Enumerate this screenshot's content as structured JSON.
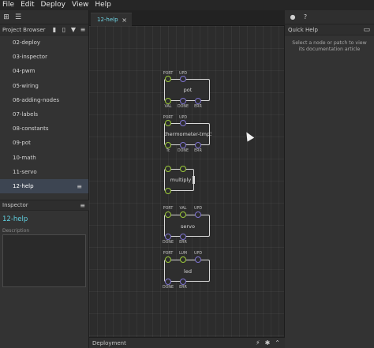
{
  "menu": [
    "File",
    "Edit",
    "Deploy",
    "View",
    "Help"
  ],
  "left_toolbar": {
    "icons": [
      "add-patch-icon",
      "sliders-icon"
    ]
  },
  "project_browser": {
    "title": "Project Browser",
    "icons": [
      "new-patch-icon",
      "document-icon",
      "filter-icon",
      "menu-icon"
    ],
    "items": [
      {
        "label": "02-deploy",
        "active": false
      },
      {
        "label": "03-inspector",
        "active": false
      },
      {
        "label": "04-pwm",
        "active": false
      },
      {
        "label": "05-wiring",
        "active": false
      },
      {
        "label": "06-adding-nodes",
        "active": false
      },
      {
        "label": "07-labels",
        "active": false
      },
      {
        "label": "08-constants",
        "active": false
      },
      {
        "label": "09-pot",
        "active": false
      },
      {
        "label": "10-math",
        "active": false
      },
      {
        "label": "11-servo",
        "active": false
      },
      {
        "label": "12-help",
        "active": true
      }
    ]
  },
  "inspector": {
    "title": "Inspector",
    "patch_name": "12-help",
    "description_label": "Description",
    "description_value": ""
  },
  "tab": {
    "label": "12-help",
    "close": "×"
  },
  "nodes": [
    {
      "name": "pot",
      "top_pins": [
        {
          "label": "PORT",
          "color": "green"
        },
        {
          "label": "UPD",
          "color": "blue"
        }
      ],
      "bottom_pins": [
        {
          "label": "VAL",
          "color": "green"
        },
        {
          "label": "DONE",
          "color": "blue"
        },
        {
          "label": "ERR",
          "color": "blue"
        }
      ]
    },
    {
      "name": "thermometer-tmp3...",
      "top_pins": [
        {
          "label": "PORT",
          "color": "green"
        },
        {
          "label": "UPD",
          "color": "blue"
        }
      ],
      "bottom_pins": [
        {
          "label": "Tc",
          "color": "green"
        },
        {
          "label": "DONE",
          "color": "blue"
        },
        {
          "label": "ERR",
          "color": "blue"
        }
      ]
    },
    {
      "name": "multiply",
      "top_pins": [
        {
          "label": "",
          "color": "green"
        },
        {
          "label": "",
          "color": "green"
        }
      ],
      "bottom_pins": [
        {
          "label": "",
          "color": "green"
        }
      ]
    },
    {
      "name": "servo",
      "top_pins": [
        {
          "label": "PORT",
          "color": "green"
        },
        {
          "label": "VAL",
          "color": "green"
        },
        {
          "label": "UPD",
          "color": "blue"
        }
      ],
      "bottom_pins": [
        {
          "label": "DONE",
          "color": "blue"
        },
        {
          "label": "ERR",
          "color": "blue"
        }
      ]
    },
    {
      "name": "led",
      "top_pins": [
        {
          "label": "PORT",
          "color": "green"
        },
        {
          "label": "LUM",
          "color": "green"
        },
        {
          "label": "UPD",
          "color": "blue"
        }
      ],
      "bottom_pins": [
        {
          "label": "DONE",
          "color": "blue"
        },
        {
          "label": "ERR",
          "color": "blue"
        }
      ]
    }
  ],
  "right_toolbar": {
    "icons": [
      "user-icon",
      "help-circle-icon"
    ]
  },
  "quick_help": {
    "title": "Quick Help",
    "text": "Select a node or patch to view its documentation article"
  },
  "deployment": {
    "title": "Deployment",
    "icons": [
      "flash-icon",
      "bug-icon",
      "chevron-up-icon"
    ]
  },
  "colors": {
    "accent": "#5fd0e0",
    "pin_green": "#9bc83a",
    "pin_blue": "#7f74d0",
    "selected_row": "#3d4552"
  }
}
